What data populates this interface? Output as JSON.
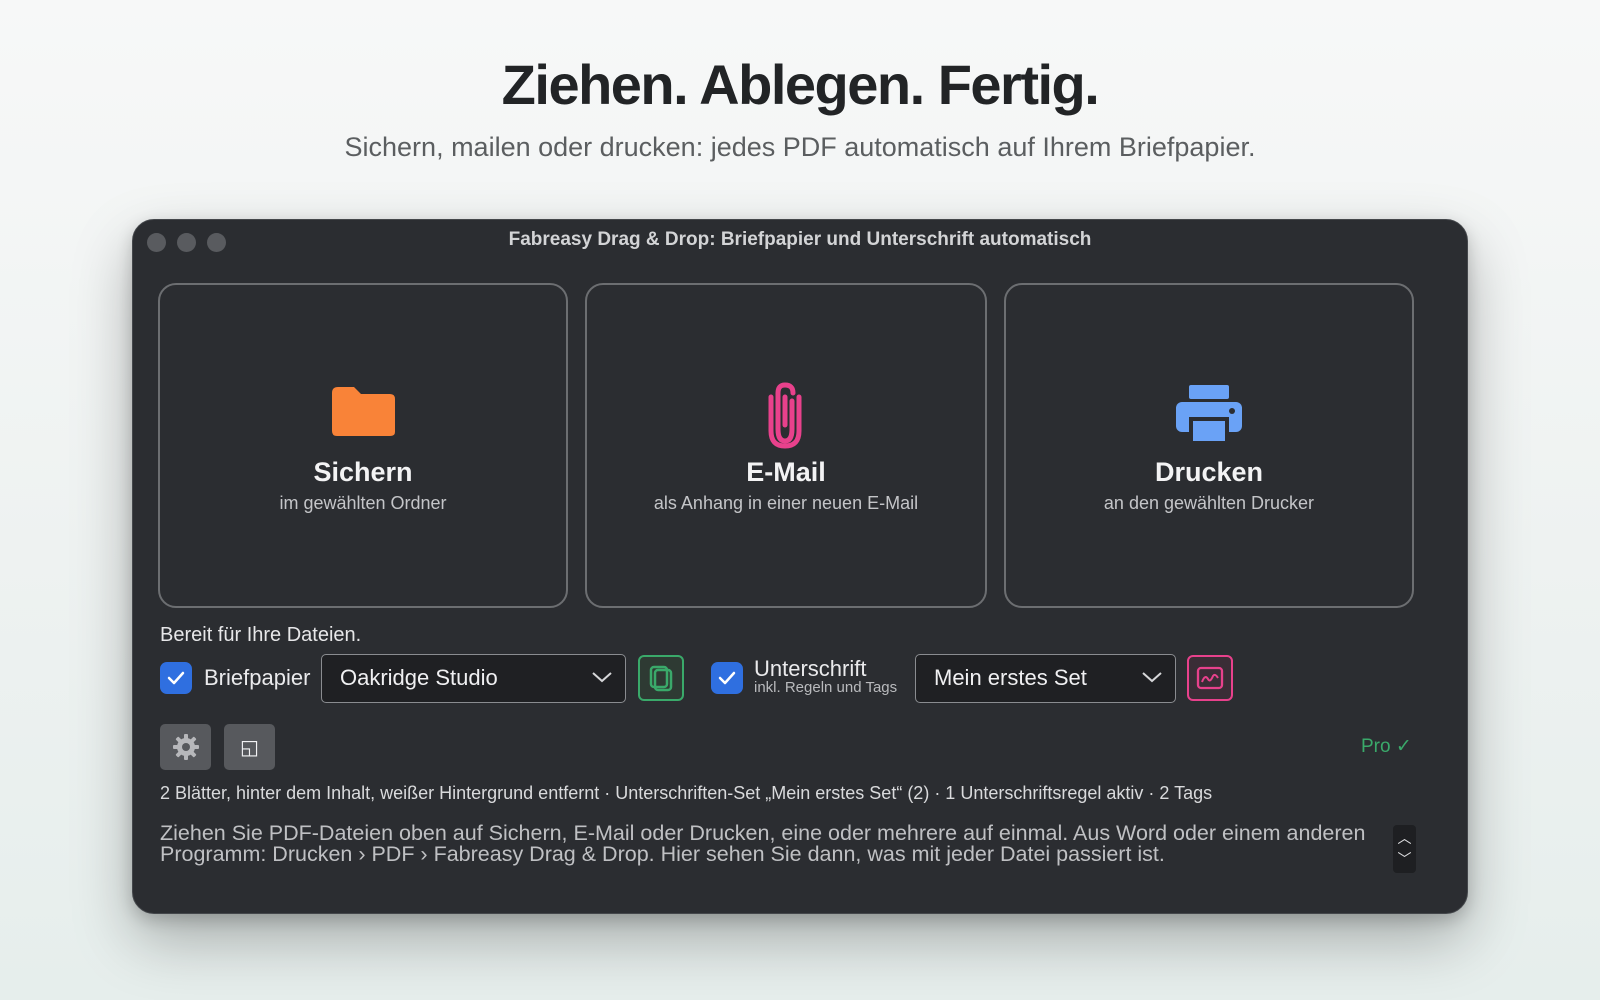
{
  "hero": {
    "headline": "Ziehen. Ablegen. Fertig.",
    "subline": "Sichern, mailen oder drucken: jedes PDF automatisch auf Ihrem Briefpapier."
  },
  "window": {
    "title": "Fabreasy Drag & Drop: Briefpapier und Unterschrift automatisch"
  },
  "dropzones": [
    {
      "title": "Sichern",
      "desc": "im gewählten Ordner",
      "icon": "folder-icon",
      "color": "#f98338"
    },
    {
      "title": "E-Mail",
      "desc": "als Anhang in einer neuen E-Mail",
      "icon": "paperclip-icon",
      "color": "#e8418c"
    },
    {
      "title": "Drucken",
      "desc": "an den gewählten Drucker",
      "icon": "printer-icon",
      "color": "#6aa2f6"
    }
  ],
  "status_text": "Bereit für Ihre Dateien.",
  "letterhead": {
    "label": "Briefpapier",
    "checked": true,
    "selected": "Oakridge Studio",
    "icon": "copy-pages-icon",
    "icon_color": "#3aa96a"
  },
  "signature": {
    "label": "Unterschrift",
    "sub_label": "inkl. Regeln und Tags",
    "checked": true,
    "selected": "Mein erstes Set",
    "icon": "signature-icon",
    "icon_color": "#e8418c"
  },
  "toolbar": {
    "settings_icon": "gear-icon",
    "window_icon": "window-icon",
    "window_glyph": "◱"
  },
  "pro_badge": "Pro ✓",
  "summary": "2 Blätter, hinter dem Inhalt, weißer Hintergrund entfernt  ·  Unterschriften-Set „Mein erstes Set“ (2)  ·  1 Unterschriftsregel aktiv  ·  2 Tags",
  "hint": "Ziehen Sie PDF-Dateien oben auf Sichern, E-Mail oder Drucken, eine oder mehrere auf einmal. Aus Word oder einem anderen Programm: Drucken › PDF › Fabreasy Drag & Drop. Hier sehen Sie dann, was mit jeder Datei passiert ist.",
  "colors": {
    "window_bg": "#2b2d31",
    "checkbox": "#2f6fe0",
    "pro": "#3aa96a"
  }
}
